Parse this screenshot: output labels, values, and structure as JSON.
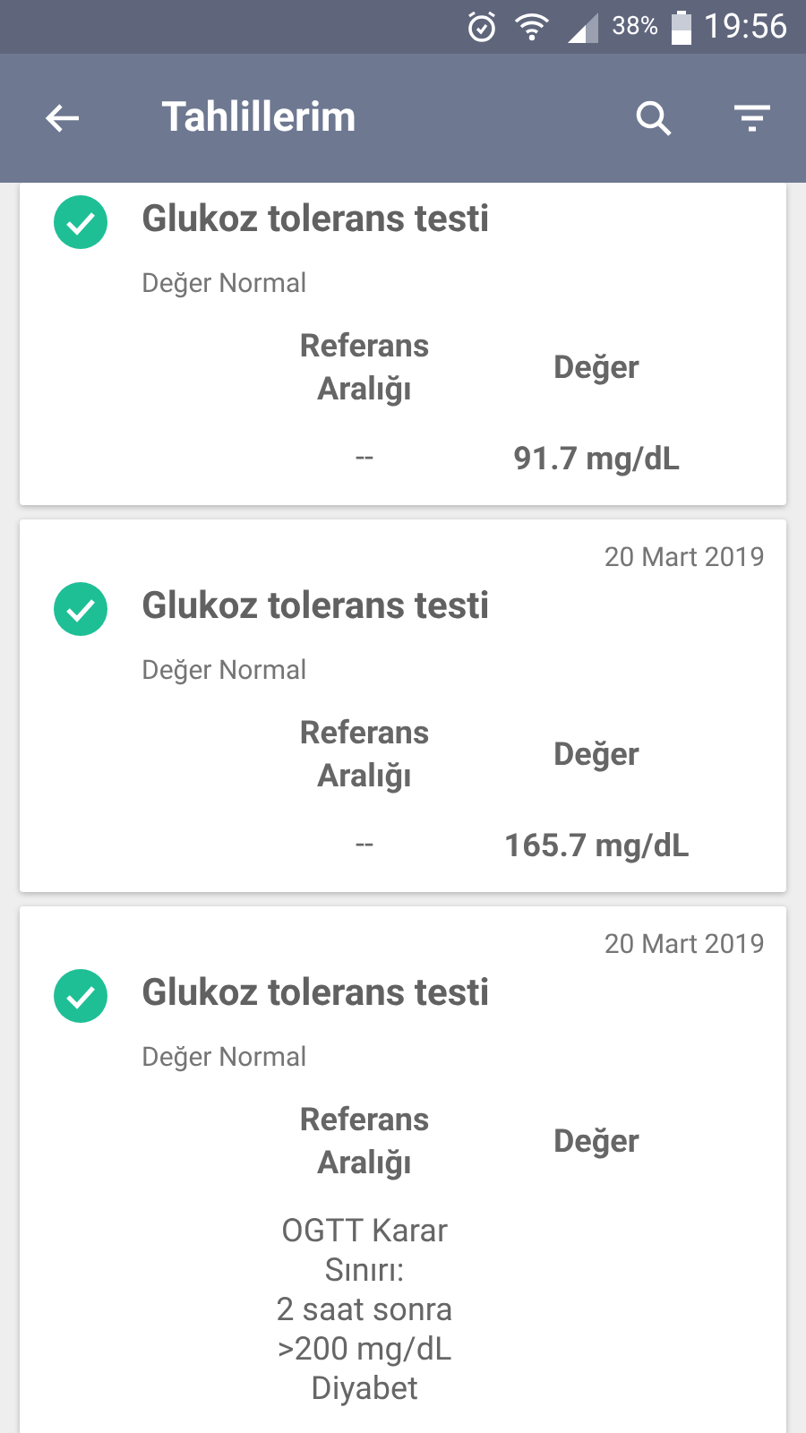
{
  "status_bar": {
    "battery": "38%",
    "time": "19:56"
  },
  "app_bar": {
    "title": "Tahlillerim"
  },
  "results": [
    {
      "name": "Glukoz tolerans testi",
      "status": "Değer Normal",
      "normal": true,
      "reference_header": "Referans\nAralığı",
      "value_header": "Değer",
      "reference": "--",
      "value": "91.7 mg/dL"
    },
    {
      "date": "20 Mart 2019",
      "name": "Glukoz tolerans testi",
      "status": "Değer Normal",
      "normal": true,
      "reference_header": "Referans\nAralığı",
      "value_header": "Değer",
      "reference": "--",
      "value": "165.7 mg/dL"
    },
    {
      "date": "20 Mart 2019",
      "name": "Glukoz tolerans testi",
      "status": "Değer Normal",
      "normal": true,
      "reference_header": "Referans\nAralığı",
      "value_header": "Değer",
      "reference": "OGTT Karar\nSınırı:\n2 saat sonra\n>200 mg/dL\nDiyabet"
    }
  ]
}
